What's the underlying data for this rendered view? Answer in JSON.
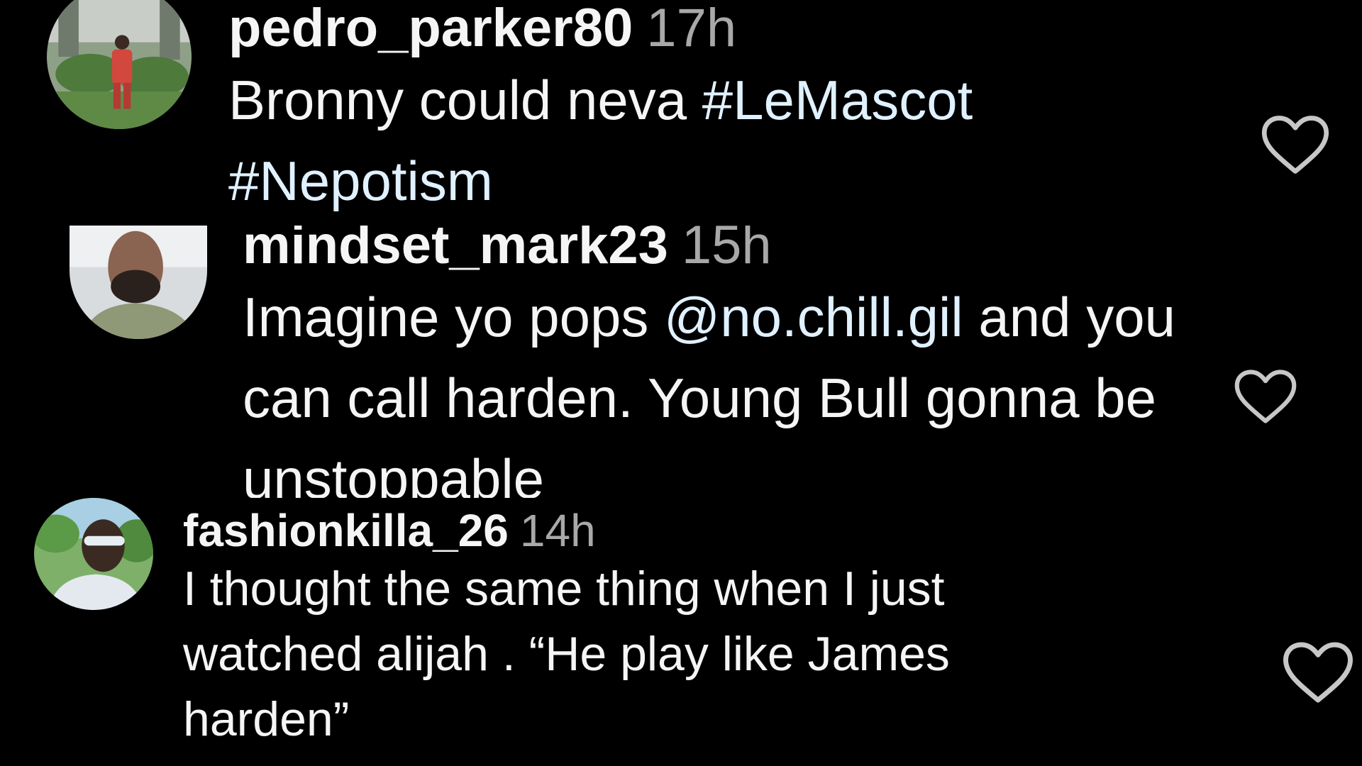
{
  "comments": [
    {
      "username": "pedro_parker80",
      "time": "17h",
      "text_before": "Bronny could neva ",
      "tags": [
        "#LeMascot",
        "#Nepotism"
      ],
      "text_after": ""
    },
    {
      "username": "mindset_mark23",
      "time": "15h",
      "text_before": "Imagine yo pops ",
      "mention": "@no.chill.gil",
      "text_after": " and you can call harden. Young Bull gonna be unstoppable"
    },
    {
      "username": "fashionkilla_26",
      "time": "14h",
      "text": "I thought the same thing when I just watched alijah . “He play like James harden”"
    }
  ],
  "icons": {
    "like": "heart-outline-icon",
    "avatar": "user-avatar"
  },
  "colors": {
    "background": "#000000",
    "text": "#f5f5f5",
    "timestamp": "#a8a8a8",
    "link": "#e0f1ff"
  }
}
